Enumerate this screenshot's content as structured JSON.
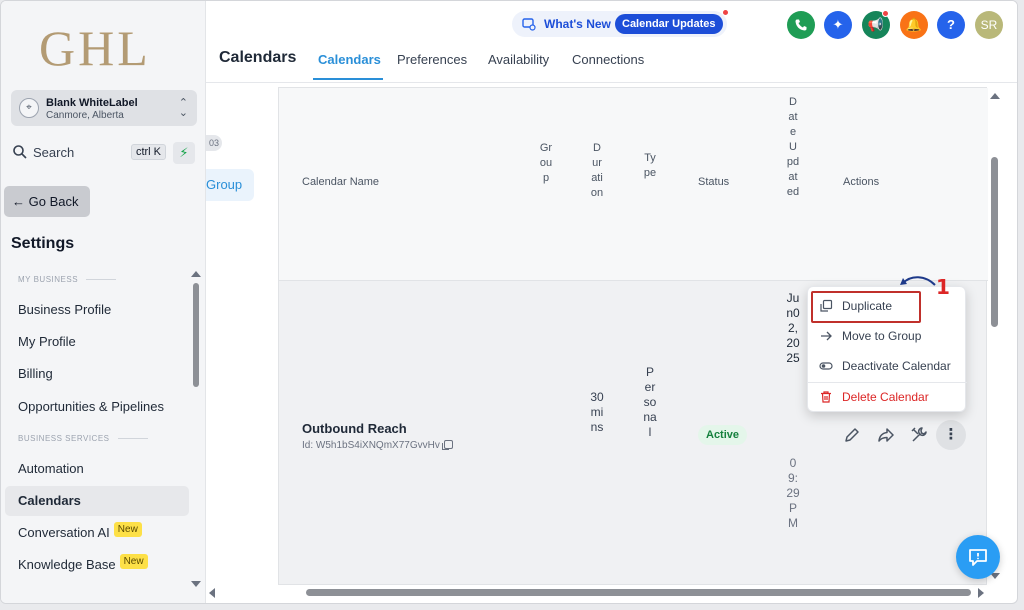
{
  "brand": {
    "logo_text": "GHL"
  },
  "location": {
    "name": "Blank WhiteLabel",
    "address": "Canmore, Alberta"
  },
  "search": {
    "label": "Search",
    "shortcut": "ctrl K"
  },
  "sidebar": {
    "back_label": "Go Back",
    "settings_title": "Settings",
    "sections": [
      {
        "label": "MY BUSINESS"
      },
      {
        "label": "BUSINESS SERVICES"
      }
    ],
    "items": [
      {
        "label": "Business Profile"
      },
      {
        "label": "My Profile"
      },
      {
        "label": "Billing"
      },
      {
        "label": "Opportunities & Pipelines"
      },
      {
        "label": "Automation"
      },
      {
        "label": "Calendars"
      },
      {
        "label": "Conversation AI",
        "badge": "New"
      },
      {
        "label": "Knowledge Base",
        "badge": "New"
      }
    ]
  },
  "header": {
    "whats_new": "What's New",
    "updates_pill": "Calendar Updates",
    "avatar_initials": "SR",
    "help_label": "?"
  },
  "page": {
    "title": "Calendars",
    "tabs": [
      {
        "label": "Calendars"
      },
      {
        "label": "Preferences"
      },
      {
        "label": "Availability"
      },
      {
        "label": "Connections"
      }
    ]
  },
  "mid_panel": {
    "count": "03",
    "group_label": "Group"
  },
  "table": {
    "columns": {
      "name": "Calendar Name",
      "group": "Group",
      "duration": "Duration",
      "type": "Type",
      "status": "Status",
      "date_updated": "DateUpdated",
      "actions": "Actions"
    },
    "row": {
      "name": "Outbound Reach",
      "id_text": "Id: W5h1bS4iXNQmX77GvvHv",
      "duration": "30mins",
      "type": "Personal",
      "status": "Active",
      "date_main": "Jun02,2025",
      "date_time": "09:29PM"
    }
  },
  "menu": {
    "items": [
      {
        "label": "Duplicate"
      },
      {
        "label": "Move to Group"
      },
      {
        "label": "Deactivate Calendar"
      },
      {
        "label": "Delete Calendar"
      }
    ],
    "step_number": "1"
  },
  "colors": {
    "accent": "#2a8fd8",
    "danger": "#dc2626",
    "active_green": "#15803d"
  }
}
